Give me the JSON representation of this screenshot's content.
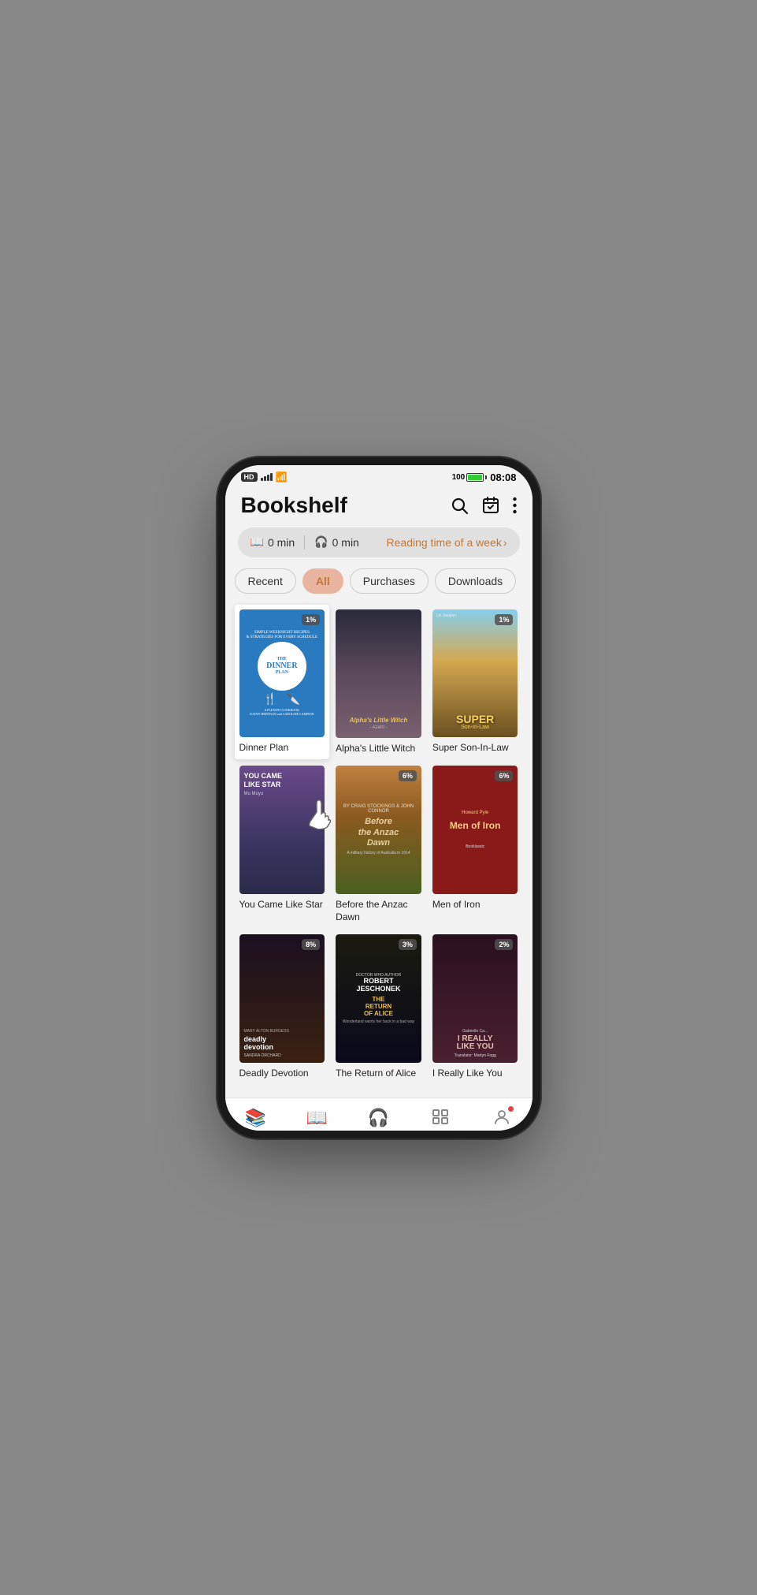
{
  "status": {
    "hd": "HD",
    "signal_bars": [
      3,
      4,
      5,
      6
    ],
    "wifi": "WiFi",
    "battery_level": "100",
    "time": "08:08"
  },
  "header": {
    "title": "Bookshelf",
    "search_label": "Search",
    "calendar_label": "Calendar",
    "more_label": "More options"
  },
  "reading_bar": {
    "book_mins": "0 min",
    "audio_mins": "0 min",
    "reading_time_link": "Reading time of a week"
  },
  "filters": {
    "tabs": [
      {
        "id": "recent",
        "label": "Recent",
        "active": false
      },
      {
        "id": "all",
        "label": "All",
        "active": true
      },
      {
        "id": "purchases",
        "label": "Purchases",
        "active": false
      },
      {
        "id": "downloads",
        "label": "Downloads",
        "active": false
      }
    ]
  },
  "books": [
    {
      "id": "dinner-plan",
      "title": "Dinner Plan",
      "progress": "1%",
      "selected": true,
      "cover_type": "dinner-plan"
    },
    {
      "id": "alphas-little-witch",
      "title": "Alpha's Little Witch",
      "progress": "",
      "selected": false,
      "cover_type": "alphas"
    },
    {
      "id": "super-son-in-law",
      "title": "Super Son-In-Law",
      "progress": "1%",
      "selected": false,
      "cover_type": "super"
    },
    {
      "id": "you-came-like-star",
      "title": "You Came Like Star",
      "progress": "",
      "selected": false,
      "cover_type": "youcame"
    },
    {
      "id": "before-anzac-dawn",
      "title": "Before the Anzac Dawn",
      "progress": "6%",
      "selected": false,
      "cover_type": "anzac"
    },
    {
      "id": "men-of-iron",
      "title": "Men of Iron",
      "progress": "6%",
      "selected": false,
      "cover_type": "men-iron"
    },
    {
      "id": "deadly-devotion",
      "title": "Deadly Devotion",
      "progress": "8%",
      "selected": false,
      "cover_type": "deadly"
    },
    {
      "id": "return-of-alice",
      "title": "The Return of Alice",
      "progress": "3%",
      "selected": false,
      "cover_type": "alice"
    },
    {
      "id": "i-really-like-you",
      "title": "I Really Like You",
      "progress": "2%",
      "selected": false,
      "cover_type": "ilike"
    }
  ],
  "bottom_nav": {
    "items": [
      {
        "id": "bookshelf",
        "label": "Bookshelf",
        "active": true,
        "icon": "📚"
      },
      {
        "id": "bookstore",
        "label": "Bookstore",
        "active": false,
        "icon": "📖"
      },
      {
        "id": "audiobooks",
        "label": "Audiobooks",
        "active": false,
        "icon": "🎧"
      },
      {
        "id": "categories",
        "label": "Categories",
        "active": false,
        "icon": "☰"
      },
      {
        "id": "me",
        "label": "Me",
        "active": false,
        "icon": "👤"
      }
    ]
  }
}
